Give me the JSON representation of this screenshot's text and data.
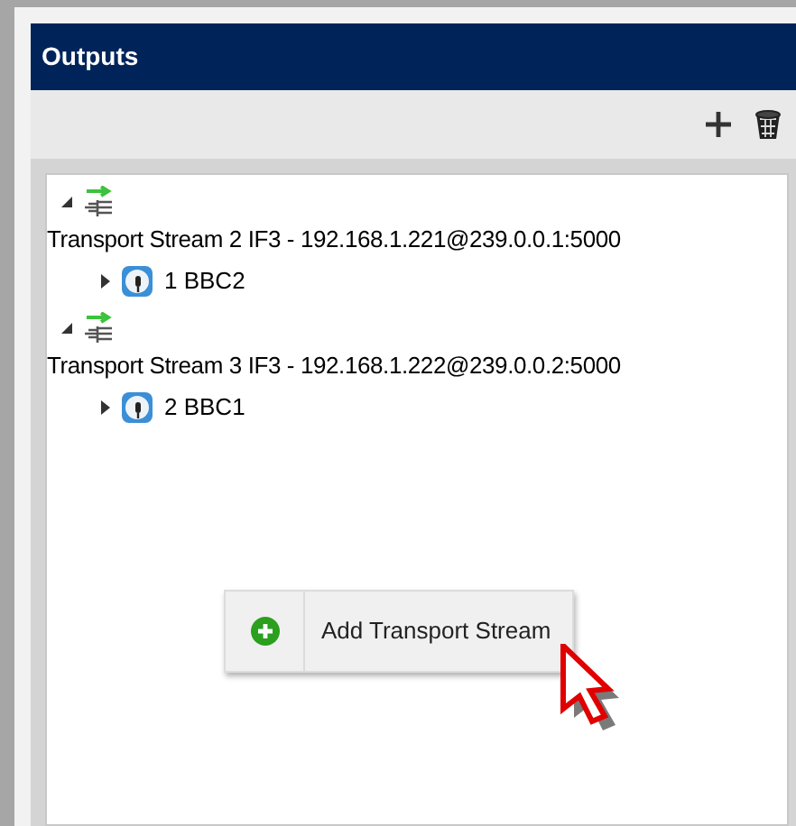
{
  "panel": {
    "title": "Outputs"
  },
  "streams": [
    {
      "label": "Transport Stream 2 IF3 - 192.168.1.221@239.0.0.1:5000",
      "expanded": true,
      "children": [
        {
          "label": "1 BBC2",
          "expanded": false
        }
      ]
    },
    {
      "label": "Transport Stream 3 IF3 - 192.168.1.222@239.0.0.2:5000",
      "expanded": true,
      "children": [
        {
          "label": "2 BBC1",
          "expanded": false
        }
      ]
    }
  ],
  "context_menu": {
    "items": [
      {
        "label": "Add Transport Stream"
      }
    ]
  }
}
